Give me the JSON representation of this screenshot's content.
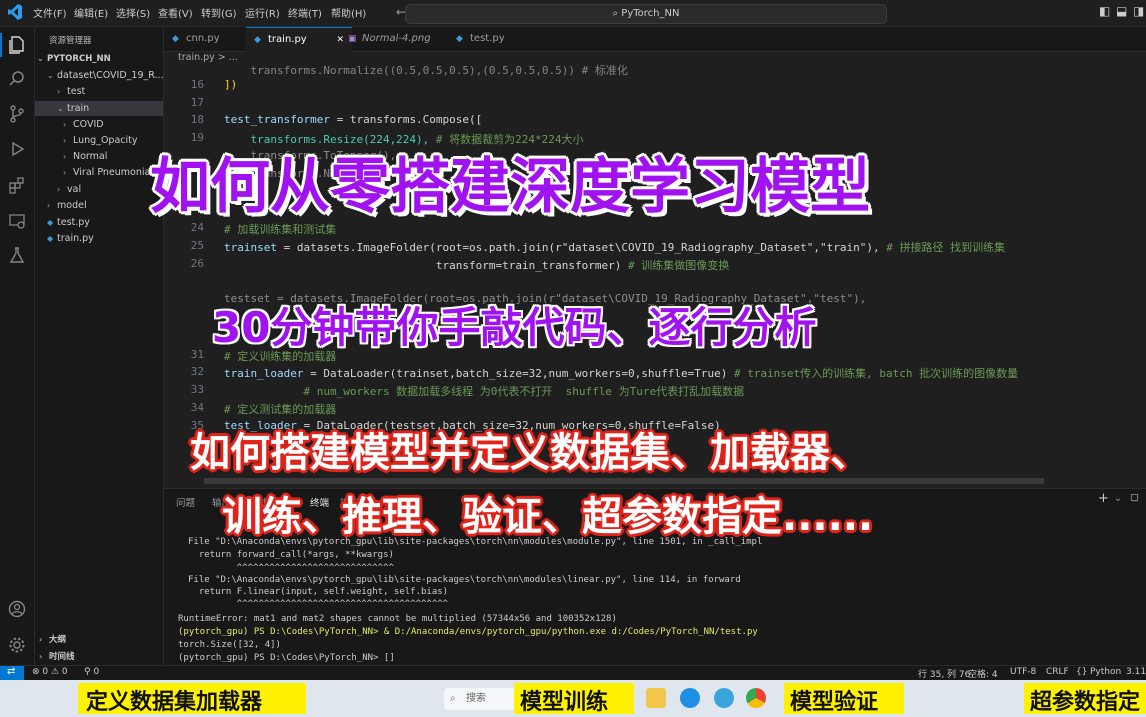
{
  "titlebar": {
    "menus": [
      "文件(F)",
      "编辑(E)",
      "选择(S)",
      "查看(V)",
      "转到(G)",
      "运行(R)",
      "终端(T)",
      "帮助(H)"
    ],
    "search": "PyTorch_NN"
  },
  "sidebar": {
    "header": "资源管理器",
    "project": "PYTORCH_NN",
    "items": {
      "dataset": "dataset\\COVID_19_R...",
      "test": "test",
      "train": "train",
      "covid": "COVID",
      "lung": "Lung_Opacity",
      "normal": "Normal",
      "viral": "Viral Pneumonia",
      "val": "val",
      "model": "model",
      "testpy": "test.py",
      "trainpy": "train.py"
    },
    "outline": "大纲",
    "timeline": "时间线"
  },
  "tabs": [
    "cnn.py",
    "train.py",
    "Normal-4.png",
    "test.py"
  ],
  "breadcrumb": "train.py > ...",
  "editor": {
    "line_numbers": [
      "16",
      "17",
      "18",
      "19",
      "24",
      "25",
      "26",
      "31",
      "32",
      "33",
      "34",
      "35"
    ],
    "line15": "    transforms.Normalize((0.5,0.5,0.5),(0.5,0.5,0.5)) # 标准化",
    "line16": "])",
    "line18a": "test_transformer",
    "line18b": " = transforms.Compose([",
    "line19a": "    transforms.Resize(224,224),",
    "line19b": " # 将数据裁剪为224*224大小",
    "line20": "    transforms.ToTensor(),",
    "line21": "    transforms.Normalize(...)",
    "line24": "# 加载训练集和测试集",
    "line25a": "trainset",
    "line25b": " = datasets.ImageFolder(root=os.path.join(r\"dataset\\COVID_19_Radiography_Dataset\",\"train\"),",
    "line25c": " # 拼接路径 找到训练集",
    "line26a": "                                transform=train_transformer)",
    "line26b": " # 训练集做图像变换",
    "line28": "testset = datasets.ImageFolder(root=os.path.join(r\"dataset\\COVID_19_Radiography_Dataset\",\"test\"),",
    "line31": "# 定义训练集的加载器",
    "line32a": "train_loader",
    "line32b": " = DataLoader(trainset,batch_size=32,num_workers=0,shuffle=True)",
    "line32c": " # trainset传入的训练集, batch 批次训练的图像数量",
    "line33": "            # num_workers 数据加载多线程 为0代表不打开  shuffle 为Ture代表打乱加载数据",
    "line34": "# 定义测试集的加载器",
    "line35a": "test_loader",
    "line35b": " = DataLoader(testset,batch_size=32,num_workers=0,shuffle=False)"
  },
  "panel": {
    "tabs": [
      "问题",
      "输出",
      "调试控制台",
      "终端",
      "端口"
    ],
    "terminal": [
      "File \"D:\\Anaconda\\envs\\pytorch_gpu\\lib\\site-packages\\torch\\nn\\modules\\module.py\", line 1501, in _call_impl",
      "  return forward_call(*args, **kwargs)",
      "         ^^^^^^^^^^^^^^^^^^^^^^^^^^^^^",
      "File \"D:\\Anaconda\\envs\\pytorch_gpu\\lib\\site-packages\\torch\\nn\\modules\\linear.py\", line 114, in forward",
      "  return F.linear(input, self.weight, self.bias)",
      "         ^^^^^^^^^^^^^^^^^^^^^^^^^^^^^^^^^^^^^^^",
      "RuntimeError: mat1 and mat2 shapes cannot be multiplied (57344x56 and 100352x128)",
      "(pytorch_gpu) PS D:\\Codes\\PyTorch_NN> & D:/Anaconda/envs/pytorch_gpu/python.exe d:/Codes/PyTorch_NN/test.py",
      "torch.Size([32, 4])",
      "(pytorch_gpu) PS D:\\Codes\\PyTorch_NN> []"
    ]
  },
  "statusbar": {
    "errors": "⊗ 0 ⚠ 0",
    "ports": "⚲ 0",
    "position": "行 35, 列 76",
    "spaces": "空格: 4",
    "encoding": "UTF-8",
    "eol": "CRLF",
    "lang_braces": "{}",
    "language": "Python",
    "version": "3.11"
  },
  "captions": {
    "title": "如何从零搭建深度学习模型",
    "subtitle": "30分钟带你手敲代码、逐行分析",
    "line3": "如何搭建模型并定义数据集、加载器、",
    "line4": "训练、推理、验证、超参数指定......"
  },
  "taskbar": {
    "search": "搜索",
    "labels": [
      "定义数据集加载器",
      "模型训练",
      "模型验证",
      "超参数指定"
    ]
  },
  "colors": {
    "accent": "#0078d4",
    "caption_purple": "#a112f0",
    "caption_red": "#e0241b",
    "band_yellow": "#fff200"
  }
}
